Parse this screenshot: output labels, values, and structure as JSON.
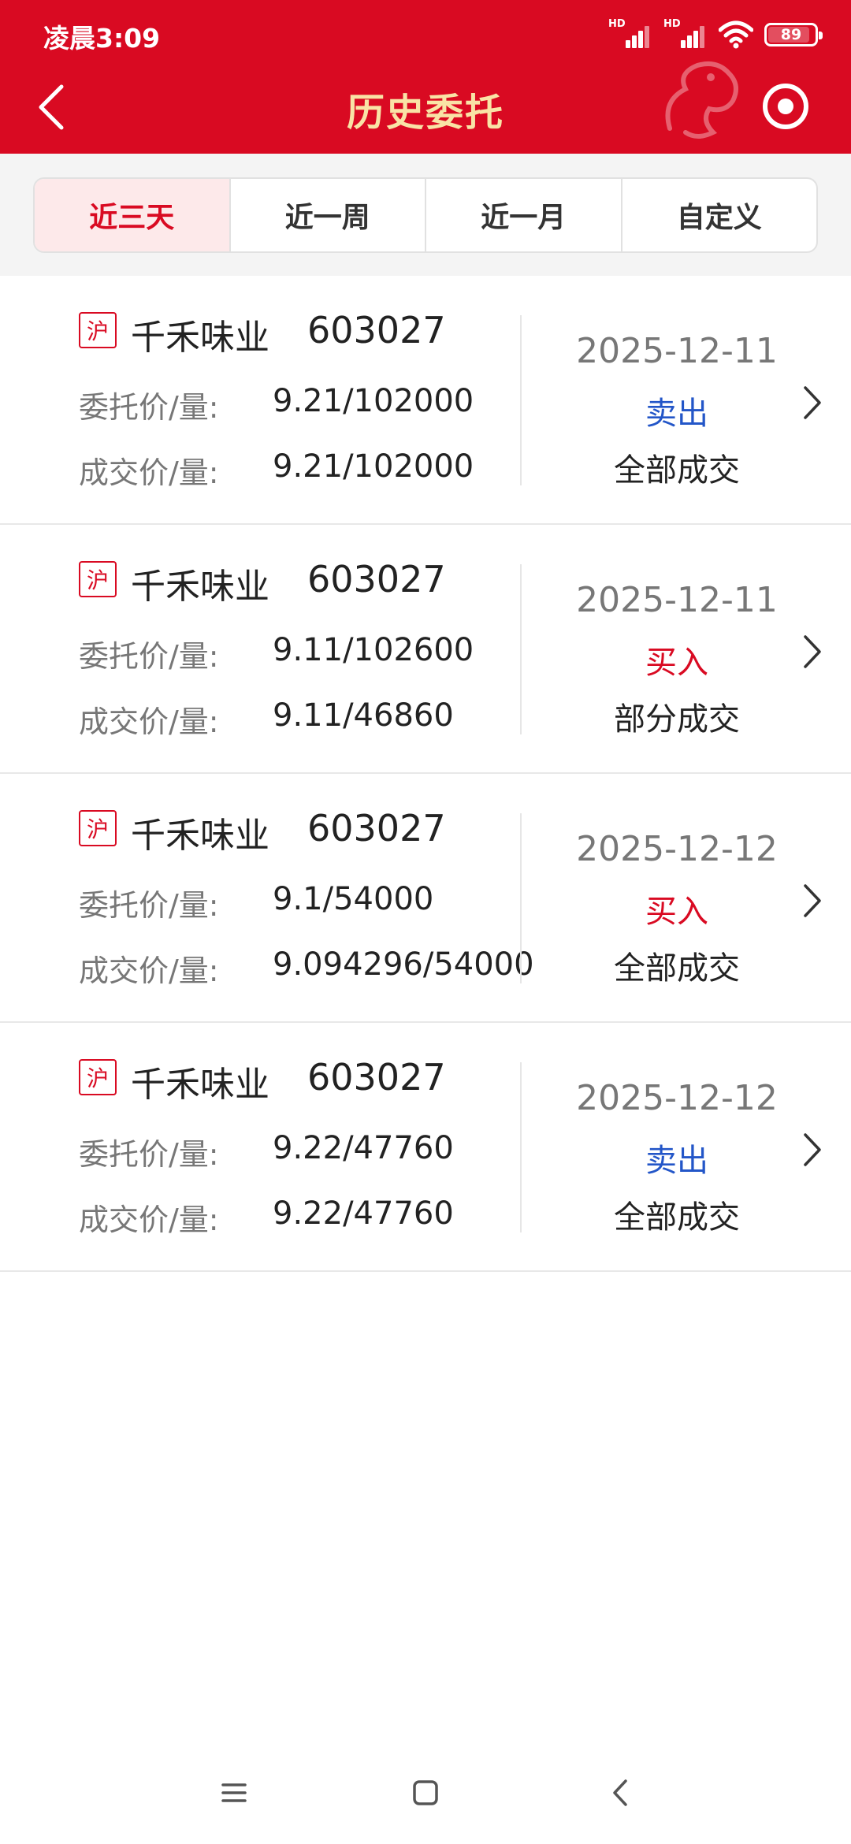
{
  "status_bar": {
    "time": "凌晨3:09",
    "signal_label_1": "HD",
    "signal_label_2": "HD",
    "battery": "89"
  },
  "header": {
    "title": "历史委托",
    "title_color": "#f9e3a6",
    "background": "#d90a22"
  },
  "tabs": [
    {
      "label": "近三天",
      "active": true
    },
    {
      "label": "近一周",
      "active": false
    },
    {
      "label": "近一月",
      "active": false
    },
    {
      "label": "自定义",
      "active": false
    }
  ],
  "labels": {
    "order_price_qty": "委托价/量:",
    "deal_price_qty": "成交价/量:"
  },
  "orders": [
    {
      "market": "沪",
      "name": "千禾味业",
      "code": "603027",
      "order": "9.21/102000",
      "deal": "9.21/102000",
      "date": "2025-12-11",
      "side": "卖出",
      "status": "全部成交"
    },
    {
      "market": "沪",
      "name": "千禾味业",
      "code": "603027",
      "order": "9.11/102600",
      "deal": "9.11/46860",
      "date": "2025-12-11",
      "side": "买入",
      "status": "部分成交"
    },
    {
      "market": "沪",
      "name": "千禾味业",
      "code": "603027",
      "order": "9.1/54000",
      "deal": "9.094296/54000",
      "date": "2025-12-12",
      "side": "买入",
      "status": "全部成交"
    },
    {
      "market": "沪",
      "name": "千禾味业",
      "code": "603027",
      "order": "9.22/47760",
      "deal": "9.22/47760",
      "date": "2025-12-12",
      "side": "卖出",
      "status": "全部成交"
    }
  ],
  "colors": {
    "sell": "#2356c8",
    "buy": "#d90a22",
    "accent": "#d90a22"
  },
  "icons": {
    "back": "chevron-left-icon",
    "record": "record-icon",
    "row_arrow": "chevron-right-icon",
    "nav_menu": "menu-icon",
    "nav_home": "home-square-icon",
    "nav_back": "back-triangle-icon"
  }
}
